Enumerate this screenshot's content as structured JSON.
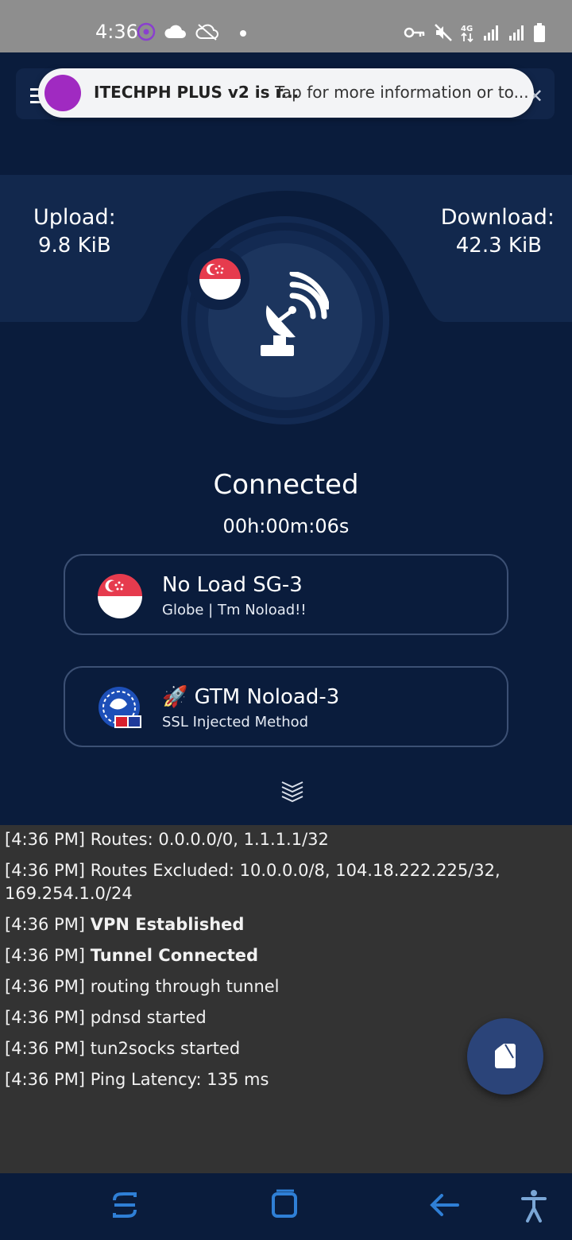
{
  "status_bar": {
    "time": "4:36",
    "left_icons": [
      "viber-icon",
      "cloud-icon",
      "cloud-off-icon",
      "dot-icon"
    ],
    "right_icons": [
      "vpn-key-icon",
      "mute-icon",
      "lte-4g-icon",
      "signal-icon",
      "signal-icon",
      "battery-icon"
    ]
  },
  "notification": {
    "title": "ITECHPH PLUS v2 is r...",
    "text": "Tap for more information or to..."
  },
  "stats": {
    "upload_label": "Upload:",
    "upload_value": "9.8 KiB",
    "download_label": "Download:",
    "download_value": "42.3 KiB"
  },
  "connection": {
    "status": "Connected",
    "timer": "00h:00m:06s"
  },
  "server_card": {
    "title": "No Load SG-3",
    "subtitle": "Globe | Tm Noload!!",
    "icon": "singapore-flag-icon"
  },
  "network_card": {
    "title": "🚀 GTM Noload-3",
    "subtitle": "SSL Injected Method",
    "icon": "globe-tm-logo-icon"
  },
  "log": [
    {
      "prefix": "[4:36 PM] ",
      "text": "Routes: 0.0.0.0/0, 1.1.1.1/32",
      "bold": false
    },
    {
      "prefix": "[4:36 PM] ",
      "text": "Routes Excluded: 10.0.0.0/8, 104.18.222.225/32,",
      "bold": false
    },
    {
      "prefix": "",
      "text": "169.254.1.0/24",
      "bold": false
    },
    {
      "prefix": "[4:36 PM] ",
      "text": "VPN Established",
      "bold": true
    },
    {
      "prefix": "[4:36 PM] ",
      "text": "Tunnel Connected",
      "bold": true
    },
    {
      "prefix": "[4:36 PM] ",
      "text": "routing through tunnel",
      "bold": false
    },
    {
      "prefix": "[4:36 PM] ",
      "text": "pdnsd started",
      "bold": false
    },
    {
      "prefix": "[4:36 PM] ",
      "text": "tun2socks started",
      "bold": false
    },
    {
      "prefix": "[4:36 PM] ",
      "text": "Ping Latency: 135 ms",
      "bold": false
    }
  ],
  "nav": [
    "recent-apps-icon",
    "home-icon",
    "back-icon",
    "accessibility-icon"
  ],
  "colors": {
    "background": "#0a1c3c",
    "log_background": "#333333",
    "accent": "#2b4479",
    "nav_icon": "#2f7fd6"
  }
}
